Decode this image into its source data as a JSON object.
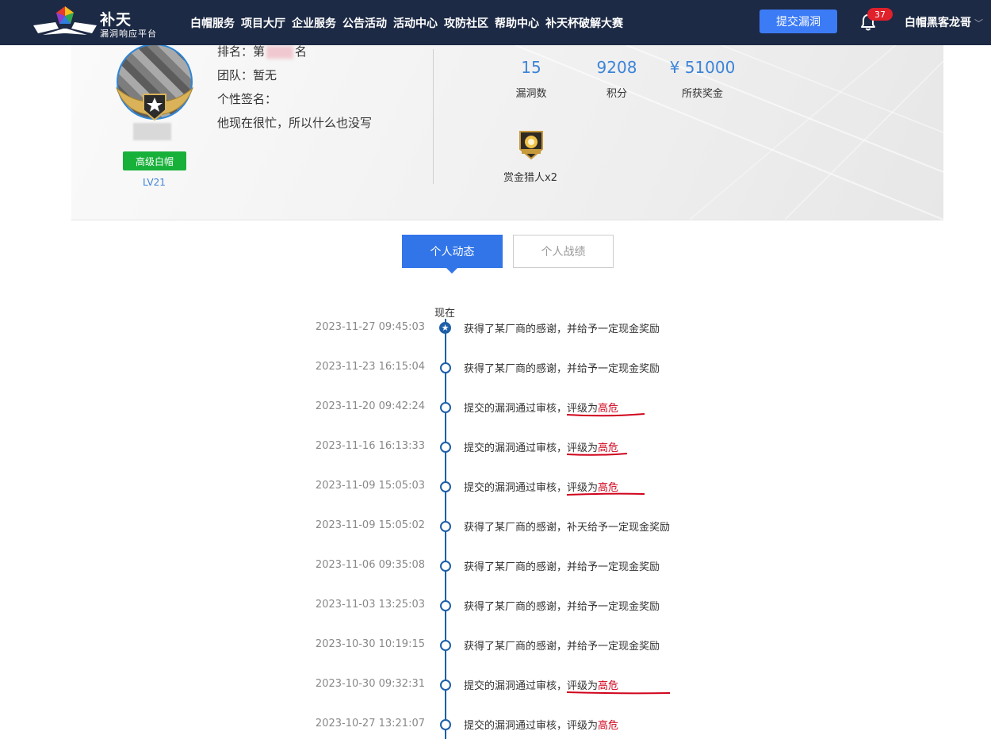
{
  "header": {
    "logo_title": "补天",
    "logo_subtitle": "漏洞响应平台",
    "nav": [
      "白帽服务",
      "项目大厅",
      "企业服务",
      "公告活动",
      "活动中心",
      "攻防社区",
      "帮助中心",
      "补天杯破解大赛"
    ],
    "submit_label": "提交漏洞",
    "notification_count": "37",
    "username": "白帽黑客龙哥"
  },
  "profile": {
    "rank_prefix": "排名：第",
    "rank_suffix": "名",
    "team": "团队：暂无",
    "signature_label": "个性签名：",
    "signature": "他现在很忙，所以什么也没写",
    "level_title": "高级白帽",
    "level": "LV21",
    "stats": [
      {
        "value": "15",
        "label": "漏洞数"
      },
      {
        "value": "9208",
        "label": "积分"
      },
      {
        "value": "¥ 51000",
        "label": "所获奖金"
      }
    ],
    "achievement": "赏金猎人x2"
  },
  "tabs": [
    "个人动态",
    "个人战绩"
  ],
  "timeline": {
    "now_label": "现在",
    "events": [
      {
        "date": "2023-11-27 09:45:03",
        "text": "获得了某厂商的感谢，并给予一定现金奖励"
      },
      {
        "date": "2023-11-23 16:15:04",
        "text": "获得了某厂商的感谢，并给予一定现金奖励"
      },
      {
        "date": "2023-11-20 09:42:24",
        "text": "提交的漏洞通过审核，",
        "rating_prefix": "评级为",
        "rating": "高危"
      },
      {
        "date": "2023-11-16 16:13:33",
        "text": "提交的漏洞通过审核，",
        "rating_prefix": "评级为",
        "rating": "高危"
      },
      {
        "date": "2023-11-09 15:05:03",
        "text": "提交的漏洞通过审核，",
        "rating_prefix": "评级为",
        "rating": "高危"
      },
      {
        "date": "2023-11-09 15:05:02",
        "text": "获得了某厂商的感谢，补天给予一定现金奖励"
      },
      {
        "date": "2023-11-06 09:35:08",
        "text": "获得了某厂商的感谢，并给予一定现金奖励"
      },
      {
        "date": "2023-11-03 13:25:03",
        "text": "获得了某厂商的感谢，并给予一定现金奖励"
      },
      {
        "date": "2023-10-30 10:19:15",
        "text": "获得了某厂商的感谢，并给予一定现金奖励"
      },
      {
        "date": "2023-10-30 09:32:31",
        "text": "提交的漏洞通过审核，",
        "rating_prefix": "评级为",
        "rating": "高危"
      },
      {
        "date": "2023-10-27 13:21:07",
        "text": "提交的漏洞通过审核，",
        "rating_prefix": "评级为",
        "rating": "高危"
      }
    ]
  }
}
